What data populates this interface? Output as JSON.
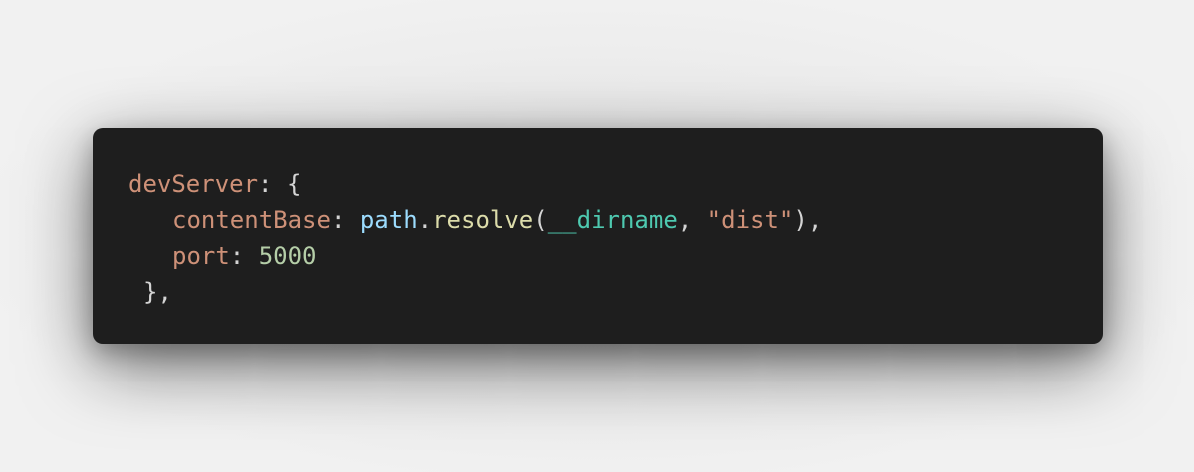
{
  "code": {
    "line1": {
      "property": "devServer",
      "punct_after": ": {"
    },
    "line2": {
      "property": "contentBase",
      "colon": ": ",
      "object": "path",
      "dot": ".",
      "function": "resolve",
      "open_paren": "(",
      "argument_var": "__dirname",
      "comma": ", ",
      "argument_str": "\"dist\"",
      "close": "),"
    },
    "line3": {
      "property": "port",
      "colon": ": ",
      "number": "5000"
    },
    "line4": {
      "closing": "},"
    }
  },
  "colors": {
    "background": "#1e1e1e",
    "property": "#ce9178",
    "punctuation": "#d4d4d4",
    "object": "#9cdcfe",
    "function": "#dcdcaa",
    "variable": "#4ec9b0",
    "string": "#ce9178",
    "number": "#b5cea8"
  }
}
